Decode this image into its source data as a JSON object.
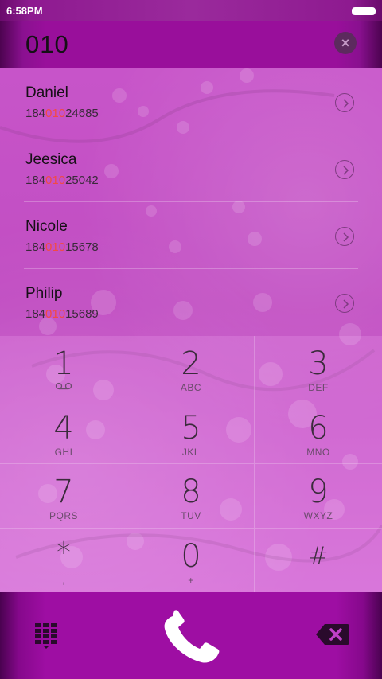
{
  "status_bar": {
    "time": "6:58PM"
  },
  "dialer": {
    "number": "010",
    "clear_icon": "clear-icon"
  },
  "contacts": [
    {
      "name": "Daniel",
      "number_pre": "184",
      "number_match": "010",
      "number_post": "24685"
    },
    {
      "name": "Jeesica",
      "number_pre": "184",
      "number_match": "010",
      "number_post": "25042"
    },
    {
      "name": "Nicole",
      "number_pre": "184",
      "number_match": "010",
      "number_post": "15678"
    },
    {
      "name": "Philip",
      "number_pre": "184",
      "number_match": "010",
      "number_post": "15689"
    }
  ],
  "keys": [
    {
      "digit": "1",
      "letters": ""
    },
    {
      "digit": "2",
      "letters": "ABC"
    },
    {
      "digit": "3",
      "letters": "DEF"
    },
    {
      "digit": "4",
      "letters": "GHI"
    },
    {
      "digit": "5",
      "letters": "JKL"
    },
    {
      "digit": "6",
      "letters": "MNO"
    },
    {
      "digit": "7",
      "letters": "PQRS"
    },
    {
      "digit": "8",
      "letters": "TUV"
    },
    {
      "digit": "9",
      "letters": "WXYZ"
    },
    {
      "digit": "*",
      "letters": ","
    },
    {
      "digit": "0",
      "letters": "+"
    },
    {
      "digit": "#",
      "letters": ""
    }
  ],
  "colors": {
    "accent": "#990f9b",
    "match_highlight": "#f24a44",
    "background": "#c650c8"
  },
  "icons": {
    "voicemail": "voicemail-icon",
    "dialpad_toggle": "dialpad-icon",
    "call": "phone-icon",
    "delete": "backspace-icon",
    "contact_detail": "chevron-right-icon"
  }
}
